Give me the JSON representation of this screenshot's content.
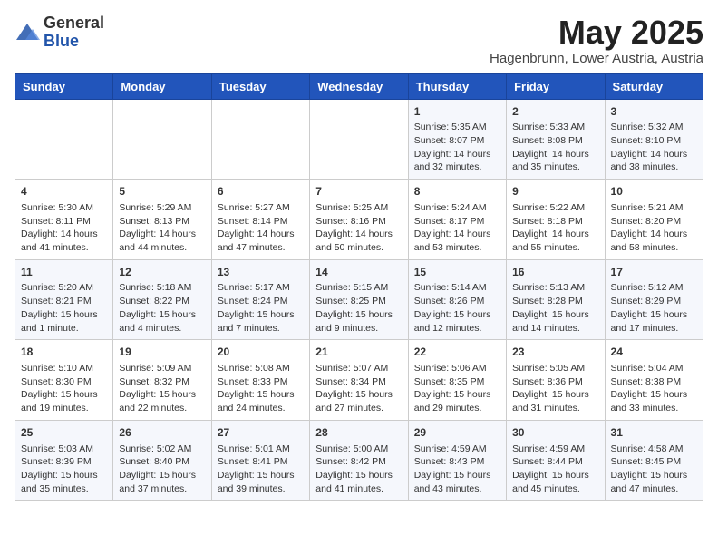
{
  "header": {
    "logo_line1": "General",
    "logo_line2": "Blue",
    "month_year": "May 2025",
    "location": "Hagenbrunn, Lower Austria, Austria"
  },
  "days_of_week": [
    "Sunday",
    "Monday",
    "Tuesday",
    "Wednesday",
    "Thursday",
    "Friday",
    "Saturday"
  ],
  "weeks": [
    [
      {
        "day": "",
        "content": ""
      },
      {
        "day": "",
        "content": ""
      },
      {
        "day": "",
        "content": ""
      },
      {
        "day": "",
        "content": ""
      },
      {
        "day": "1",
        "content": "Sunrise: 5:35 AM\nSunset: 8:07 PM\nDaylight: 14 hours\nand 32 minutes."
      },
      {
        "day": "2",
        "content": "Sunrise: 5:33 AM\nSunset: 8:08 PM\nDaylight: 14 hours\nand 35 minutes."
      },
      {
        "day": "3",
        "content": "Sunrise: 5:32 AM\nSunset: 8:10 PM\nDaylight: 14 hours\nand 38 minutes."
      }
    ],
    [
      {
        "day": "4",
        "content": "Sunrise: 5:30 AM\nSunset: 8:11 PM\nDaylight: 14 hours\nand 41 minutes."
      },
      {
        "day": "5",
        "content": "Sunrise: 5:29 AM\nSunset: 8:13 PM\nDaylight: 14 hours\nand 44 minutes."
      },
      {
        "day": "6",
        "content": "Sunrise: 5:27 AM\nSunset: 8:14 PM\nDaylight: 14 hours\nand 47 minutes."
      },
      {
        "day": "7",
        "content": "Sunrise: 5:25 AM\nSunset: 8:16 PM\nDaylight: 14 hours\nand 50 minutes."
      },
      {
        "day": "8",
        "content": "Sunrise: 5:24 AM\nSunset: 8:17 PM\nDaylight: 14 hours\nand 53 minutes."
      },
      {
        "day": "9",
        "content": "Sunrise: 5:22 AM\nSunset: 8:18 PM\nDaylight: 14 hours\nand 55 minutes."
      },
      {
        "day": "10",
        "content": "Sunrise: 5:21 AM\nSunset: 8:20 PM\nDaylight: 14 hours\nand 58 minutes."
      }
    ],
    [
      {
        "day": "11",
        "content": "Sunrise: 5:20 AM\nSunset: 8:21 PM\nDaylight: 15 hours\nand 1 minute."
      },
      {
        "day": "12",
        "content": "Sunrise: 5:18 AM\nSunset: 8:22 PM\nDaylight: 15 hours\nand 4 minutes."
      },
      {
        "day": "13",
        "content": "Sunrise: 5:17 AM\nSunset: 8:24 PM\nDaylight: 15 hours\nand 7 minutes."
      },
      {
        "day": "14",
        "content": "Sunrise: 5:15 AM\nSunset: 8:25 PM\nDaylight: 15 hours\nand 9 minutes."
      },
      {
        "day": "15",
        "content": "Sunrise: 5:14 AM\nSunset: 8:26 PM\nDaylight: 15 hours\nand 12 minutes."
      },
      {
        "day": "16",
        "content": "Sunrise: 5:13 AM\nSunset: 8:28 PM\nDaylight: 15 hours\nand 14 minutes."
      },
      {
        "day": "17",
        "content": "Sunrise: 5:12 AM\nSunset: 8:29 PM\nDaylight: 15 hours\nand 17 minutes."
      }
    ],
    [
      {
        "day": "18",
        "content": "Sunrise: 5:10 AM\nSunset: 8:30 PM\nDaylight: 15 hours\nand 19 minutes."
      },
      {
        "day": "19",
        "content": "Sunrise: 5:09 AM\nSunset: 8:32 PM\nDaylight: 15 hours\nand 22 minutes."
      },
      {
        "day": "20",
        "content": "Sunrise: 5:08 AM\nSunset: 8:33 PM\nDaylight: 15 hours\nand 24 minutes."
      },
      {
        "day": "21",
        "content": "Sunrise: 5:07 AM\nSunset: 8:34 PM\nDaylight: 15 hours\nand 27 minutes."
      },
      {
        "day": "22",
        "content": "Sunrise: 5:06 AM\nSunset: 8:35 PM\nDaylight: 15 hours\nand 29 minutes."
      },
      {
        "day": "23",
        "content": "Sunrise: 5:05 AM\nSunset: 8:36 PM\nDaylight: 15 hours\nand 31 minutes."
      },
      {
        "day": "24",
        "content": "Sunrise: 5:04 AM\nSunset: 8:38 PM\nDaylight: 15 hours\nand 33 minutes."
      }
    ],
    [
      {
        "day": "25",
        "content": "Sunrise: 5:03 AM\nSunset: 8:39 PM\nDaylight: 15 hours\nand 35 minutes."
      },
      {
        "day": "26",
        "content": "Sunrise: 5:02 AM\nSunset: 8:40 PM\nDaylight: 15 hours\nand 37 minutes."
      },
      {
        "day": "27",
        "content": "Sunrise: 5:01 AM\nSunset: 8:41 PM\nDaylight: 15 hours\nand 39 minutes."
      },
      {
        "day": "28",
        "content": "Sunrise: 5:00 AM\nSunset: 8:42 PM\nDaylight: 15 hours\nand 41 minutes."
      },
      {
        "day": "29",
        "content": "Sunrise: 4:59 AM\nSunset: 8:43 PM\nDaylight: 15 hours\nand 43 minutes."
      },
      {
        "day": "30",
        "content": "Sunrise: 4:59 AM\nSunset: 8:44 PM\nDaylight: 15 hours\nand 45 minutes."
      },
      {
        "day": "31",
        "content": "Sunrise: 4:58 AM\nSunset: 8:45 PM\nDaylight: 15 hours\nand 47 minutes."
      }
    ]
  ]
}
